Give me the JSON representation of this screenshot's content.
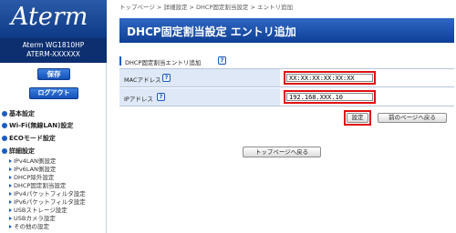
{
  "brand": {
    "logo": "Aterm"
  },
  "device": {
    "model": "Aterm WG1810HP",
    "name": "ATERM-XXXXXX"
  },
  "sidebar": {
    "save_label": "保存",
    "logout_label": "ログアウト",
    "sections": [
      {
        "label": "基本設定"
      },
      {
        "label": "Wi-Fi(無線LAN)設定"
      },
      {
        "label": "ECOモード設定"
      },
      {
        "label": "詳細設定"
      }
    ],
    "sub_items": [
      {
        "label": "IPv4LAN側設定"
      },
      {
        "label": "IPv6LAN側設定"
      },
      {
        "label": "DHCP除外設定"
      },
      {
        "label": "DHCP固定割当設定"
      },
      {
        "label": "IPv4パケットフィルタ設定"
      },
      {
        "label": "IPv6パケットフィルタ設定"
      },
      {
        "label": "USBストレージ設定"
      },
      {
        "label": "USBカメラ設定"
      },
      {
        "label": "その他の設定"
      }
    ]
  },
  "breadcrumb": "トップページ > 詳細設定 > DHCP固定割当設定 > エントリ追加",
  "page_title": "DHCP固定割当設定 エントリ追加",
  "section": {
    "title": "DHCP固定割当エントリ追加",
    "help": "?"
  },
  "form": {
    "mac": {
      "label": "MACアドレス",
      "value": "XX:XX:XX:XX:XX:XX"
    },
    "ip": {
      "label": "IPアドレス",
      "value": "192.168.XXX.10"
    }
  },
  "buttons": {
    "set": "設定",
    "back": "前のページへ戻る",
    "top": "トップページへ戻る"
  },
  "icons": {
    "help": "help-icon"
  },
  "colors": {
    "accent": "#1452b8",
    "highlight": "#e01010",
    "label_bg": "#dfe8f6"
  }
}
